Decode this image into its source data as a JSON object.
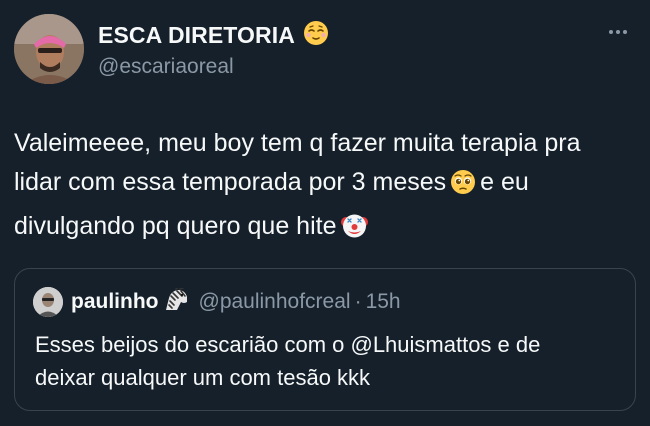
{
  "author": {
    "display_name": "ESCA DIRETORIA",
    "handle": "@escariaoreal",
    "name_emoji": "relieved-face-emoji",
    "avatar": "avatar"
  },
  "more_icon": "more-horizontal-icon",
  "tweet": {
    "lines": [
      {
        "text": "Valeimeeee, meu boy tem q fazer muita terapia pra"
      },
      {
        "text": "lidar com essa temporada por 3 meses",
        "emoji": "pleading-face-emoji",
        "after": "e eu"
      },
      {
        "text": "divulgando pq quero que hite",
        "emoji": "clown-face-emoji"
      }
    ]
  },
  "quoted": {
    "display_name": "paulinho",
    "name_emoji": "zebra-emoji",
    "handle": "@paulinhofcreal",
    "separator": "·",
    "time": "15h",
    "lines": [
      "Esses beijos do escarião com o @Lhuismattos e de",
      "deixar qualquer um com tesão kkk"
    ]
  },
  "colors": {
    "background": "#15202b",
    "text": "#f7f9f9",
    "secondary": "#8b98a5",
    "border": "#38444d"
  }
}
